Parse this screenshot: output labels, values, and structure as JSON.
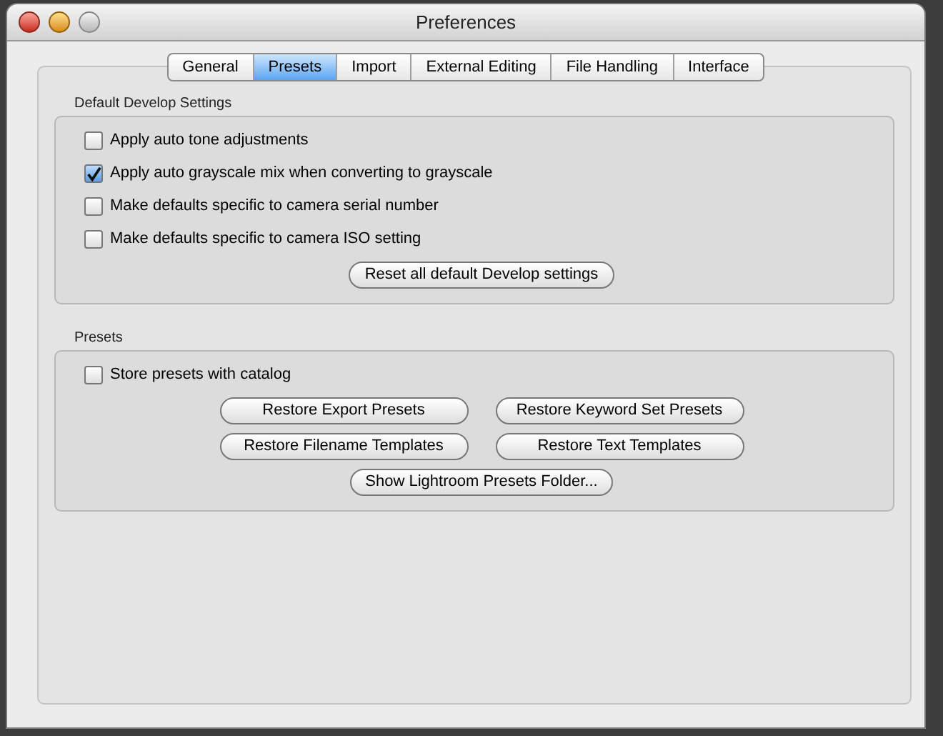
{
  "window": {
    "title": "Preferences"
  },
  "tabs": [
    {
      "label": "General",
      "selected": false
    },
    {
      "label": "Presets",
      "selected": true
    },
    {
      "label": "Import",
      "selected": false
    },
    {
      "label": "External Editing",
      "selected": false
    },
    {
      "label": "File Handling",
      "selected": false
    },
    {
      "label": "Interface",
      "selected": false
    }
  ],
  "groups": [
    {
      "title": "Default Develop Settings",
      "checkboxes": [
        {
          "label": "Apply auto tone adjustments",
          "checked": false
        },
        {
          "label": "Apply auto grayscale mix when converting to grayscale",
          "checked": true
        },
        {
          "label": "Make defaults specific to camera serial number",
          "checked": false
        },
        {
          "label": "Make defaults specific to camera ISO setting",
          "checked": false
        }
      ],
      "button_rows": [
        [
          "Reset all default Develop settings"
        ]
      ]
    },
    {
      "title": "Presets",
      "checkboxes": [
        {
          "label": "Store presets with catalog",
          "checked": false
        }
      ],
      "button_rows": [
        [
          "Restore Export Presets",
          "Restore Keyword Set Presets"
        ],
        [
          "Restore Filename Templates",
          "Restore Text Templates"
        ],
        [
          "Show Lightroom Presets Folder..."
        ]
      ]
    }
  ]
}
